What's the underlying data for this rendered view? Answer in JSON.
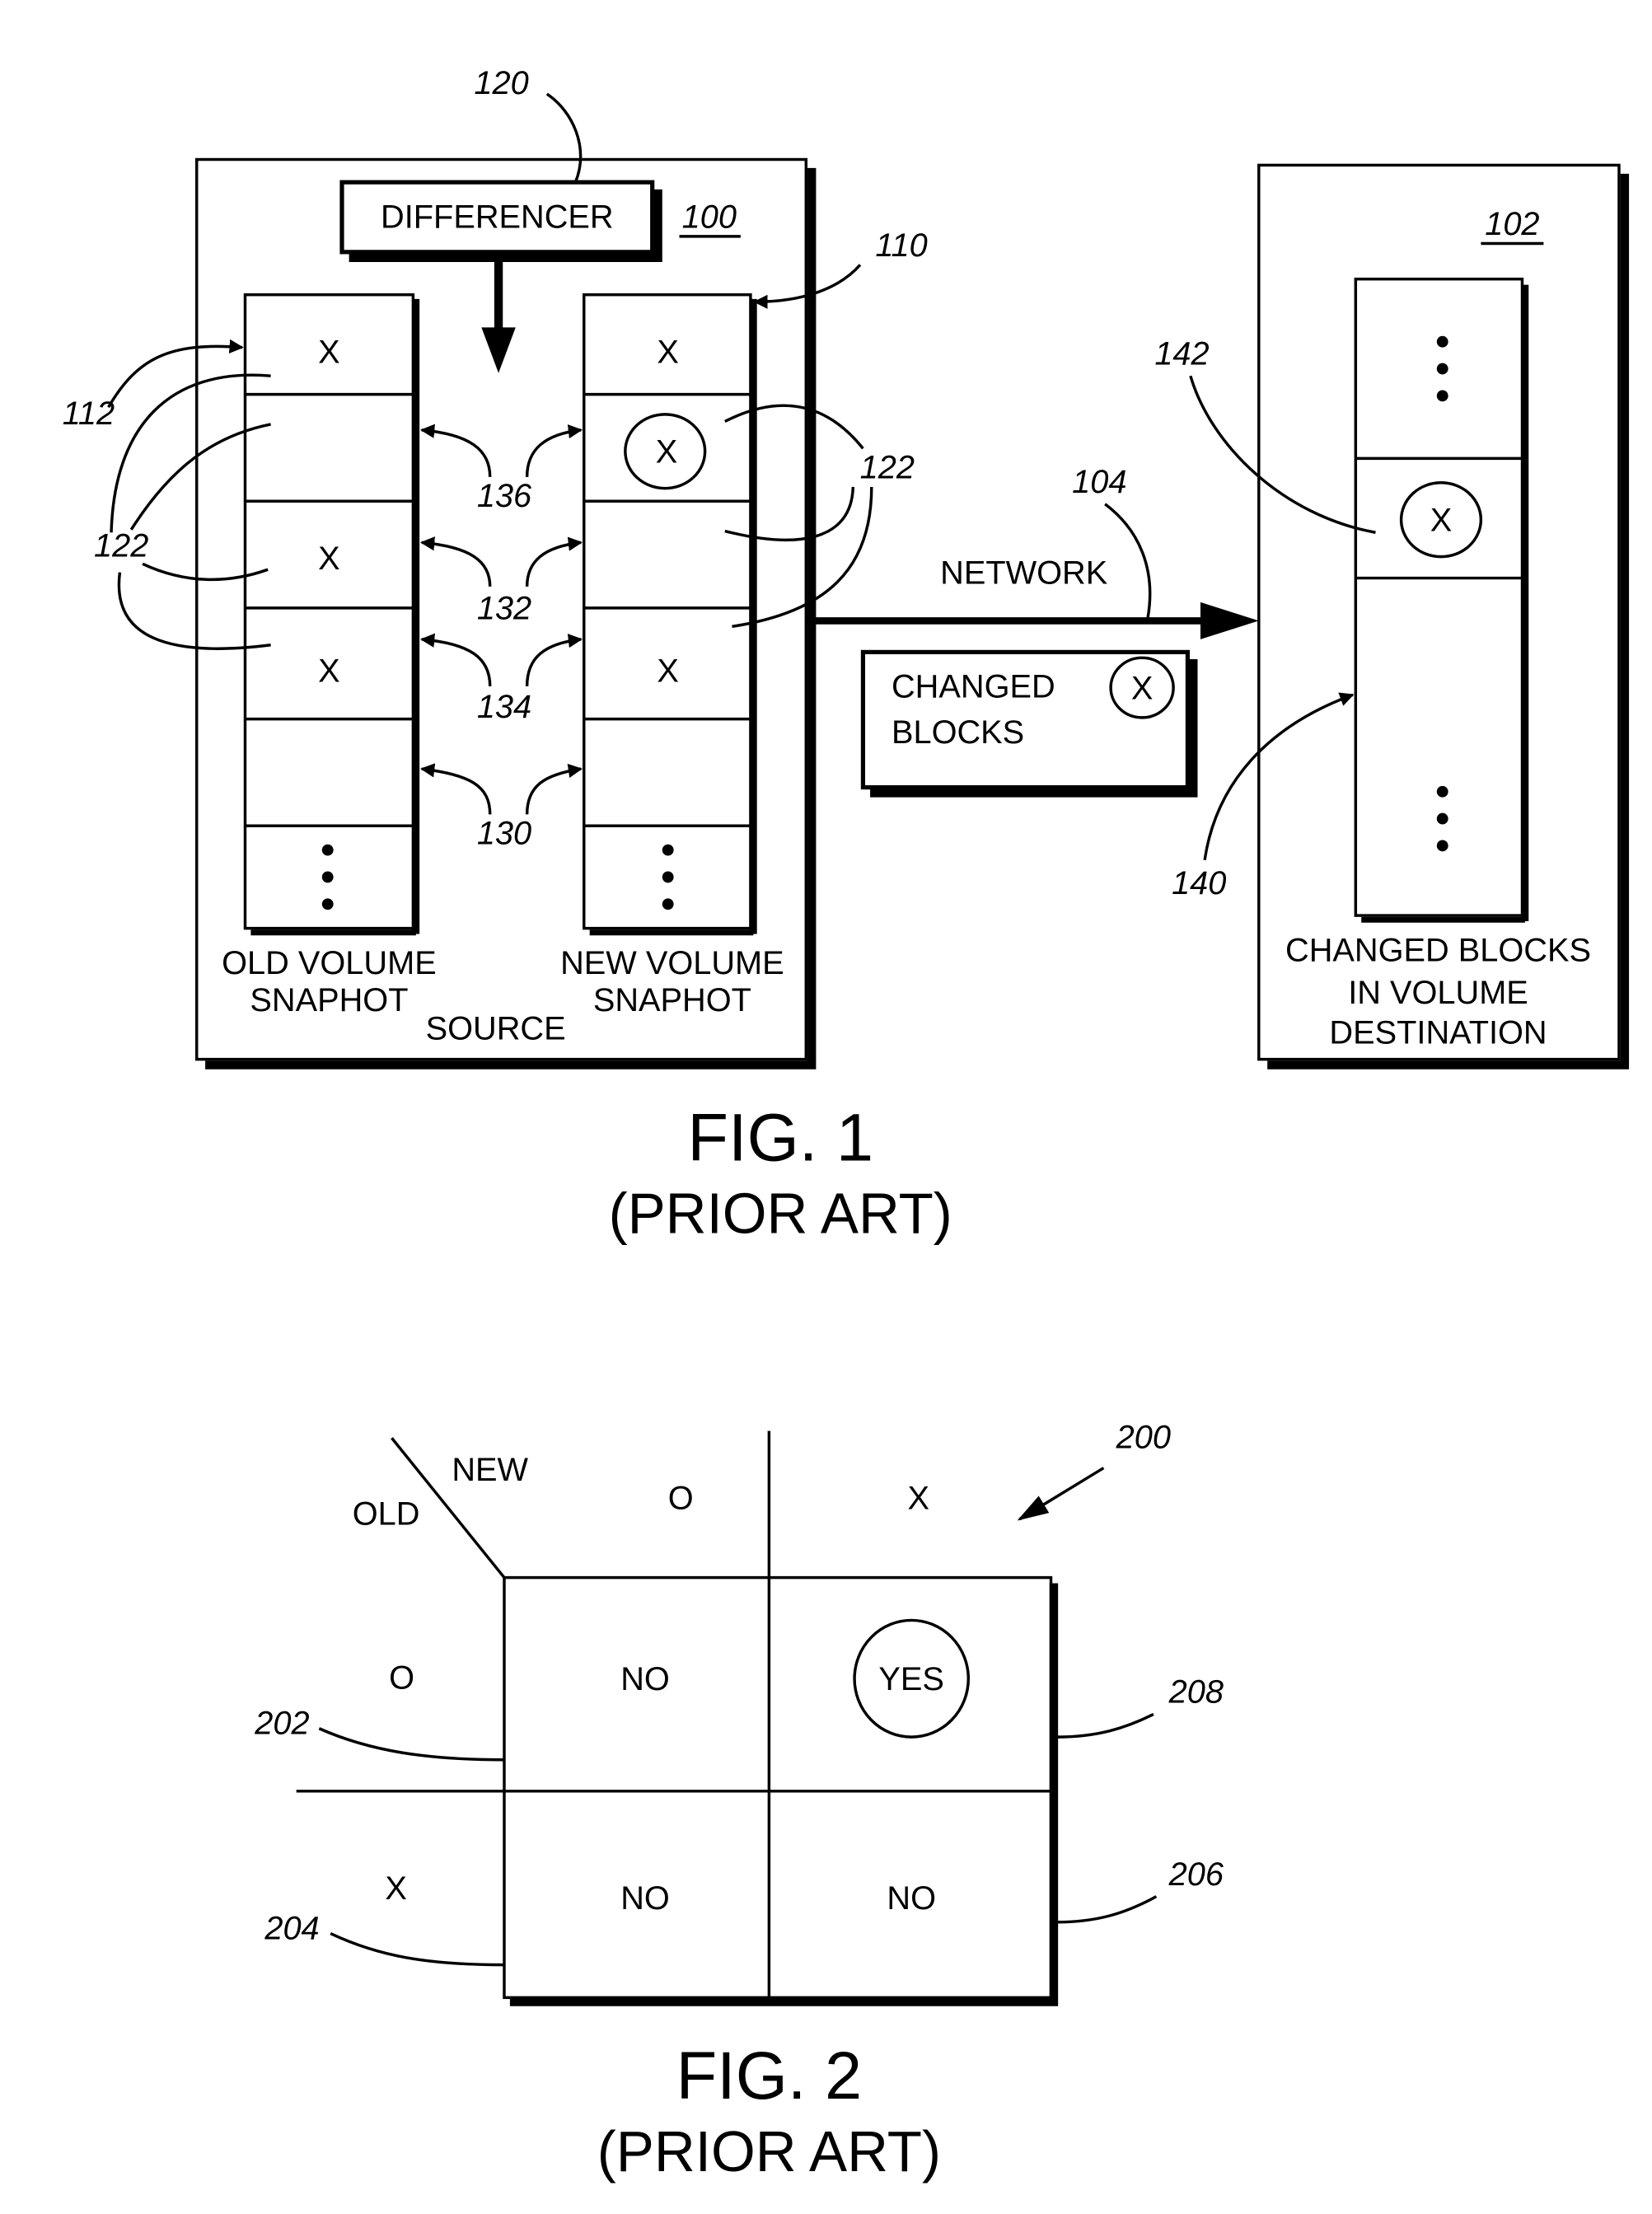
{
  "figure1": {
    "source_system": {
      "ref": "100",
      "caption": "SOURCE",
      "differencer": {
        "label": "DIFFERENCER",
        "ref": "120"
      },
      "old_snapshot": {
        "label_line1": "OLD VOLUME",
        "label_line2": "SNAPHOT",
        "blocks": [
          "X",
          "",
          "X",
          "X",
          "",
          "..."
        ]
      },
      "new_snapshot": {
        "ref": "110",
        "label_line1": "NEW VOLUME",
        "label_line2": "SNAPHOT",
        "blocks": [
          "X",
          "(X)",
          "",
          "X",
          "",
          "..."
        ]
      },
      "refs": {
        "block_pointer": "112",
        "blocks_left": "122",
        "blocks_right": "122",
        "pair_136": "136",
        "pair_132": "132",
        "pair_134": "134",
        "pair_130": "130"
      }
    },
    "network": {
      "label": "NETWORK",
      "ref": "104"
    },
    "changed_blocks_box": {
      "line1": "CHANGED",
      "line2": "BLOCKS",
      "symbol": "X"
    },
    "destination_system": {
      "ref": "102",
      "label_line1": "CHANGED BLOCKS",
      "label_line2": "IN VOLUME",
      "label_line3": "DESTINATION",
      "blocks": [
        "...",
        "(X)",
        "..."
      ],
      "refs": {
        "changed_block": "142",
        "volume": "140"
      }
    },
    "caption": {
      "title": "FIG. 1",
      "subtitle": "(PRIOR ART)"
    }
  },
  "figure2": {
    "ref": "200",
    "header": {
      "new": "NEW",
      "old": "OLD"
    },
    "columns": [
      "O",
      "X"
    ],
    "rows": [
      "O",
      "X"
    ],
    "cells": [
      [
        "NO",
        "YES"
      ],
      [
        "NO",
        "NO"
      ]
    ],
    "highlighted_cell": "YES",
    "refs": {
      "row_o": "202",
      "row_x": "204",
      "cell_yes": "208",
      "cell_no": "206"
    },
    "caption": {
      "title": "FIG. 2",
      "subtitle": "(PRIOR ART)"
    }
  }
}
